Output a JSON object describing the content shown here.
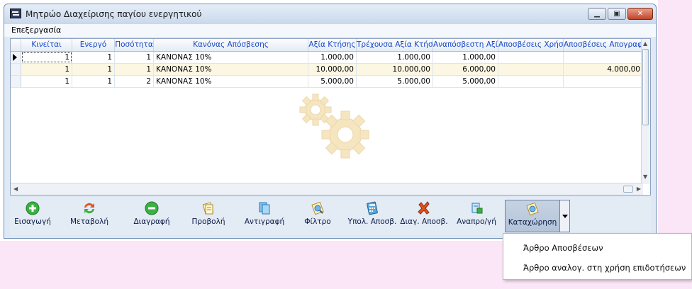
{
  "window": {
    "title": "Μητρώο Διαχείρισης παγίου ενεργητικού",
    "controls": {
      "minimize": "▁",
      "maximize": "▣",
      "close": "✕"
    }
  },
  "menu": {
    "items": [
      "Επεξεργασία"
    ]
  },
  "grid": {
    "columns": [
      "Κινείται",
      "Ενεργό",
      "Ποσότητα",
      "Κανόνας Απόσβεσης",
      "Αξία Κτήσης",
      "Τρέχουσα Αξία Κτήσης",
      "Αναπόσβεστη Αξία",
      "Αποσβέσεις Χρήσης",
      "Αποσβέσεις Απογραφής"
    ],
    "rows": [
      [
        "1",
        "1",
        "1",
        "ΚΑΝΟΝΑΣ 10%",
        "1.000,00",
        "1.000,00",
        "1.000,00",
        "",
        ""
      ],
      [
        "1",
        "1",
        "1",
        "ΚΑΝΟΝΑΣ 10%",
        "10.000,00",
        "10.000,00",
        "6.000,00",
        "",
        "4.000,00"
      ],
      [
        "1",
        "1",
        "2",
        "ΚΑΝΟΝΑΣ 10%",
        "5.000,00",
        "5.000,00",
        "5.000,00",
        "",
        ""
      ]
    ]
  },
  "toolbar": {
    "buttons": [
      {
        "label": "Εισαγωγή",
        "icon": "add-icon"
      },
      {
        "label": "Μεταβολή",
        "icon": "refresh-icon"
      },
      {
        "label": "Διαγραφή",
        "icon": "remove-icon"
      },
      {
        "label": "Προβολή",
        "icon": "view-icon"
      },
      {
        "label": "Αντιγραφή",
        "icon": "copy-icon"
      },
      {
        "label": "Φίλτρο",
        "icon": "filter-icon"
      },
      {
        "label": "Υπολ. Αποσβ.",
        "icon": "calculator-icon"
      },
      {
        "label": "Διαγ. Αποσβ.",
        "icon": "delete-cross-icon"
      },
      {
        "label": "Αναπρο/γή",
        "icon": "revaluation-icon"
      },
      {
        "label": "Καταχώρηση",
        "icon": "post-icon"
      }
    ]
  },
  "dropdown_menu": {
    "items": [
      "Άρθρο Αποσβέσεων",
      "Άρθρο αναλογ. στη χρήση επιδοτήσεων"
    ]
  }
}
